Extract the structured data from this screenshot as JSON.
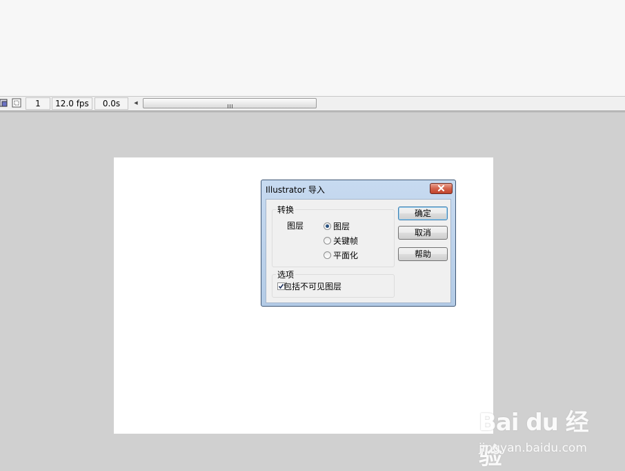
{
  "status_bar": {
    "frame": "1",
    "fps": "12.0 fps",
    "time": "0.0s",
    "scroll_left_icon": "scroll-left-arrow",
    "grip": "III"
  },
  "dialog": {
    "title": "Illustrator 导入",
    "convert_group": {
      "label": "转换",
      "row_label": "图层",
      "options": [
        {
          "label": "图层",
          "selected": true
        },
        {
          "label": "关键帧",
          "selected": false
        },
        {
          "label": "平面化",
          "selected": false
        }
      ]
    },
    "options_group": {
      "label": "选项",
      "include_invisible_label": "包括不可见图层",
      "include_invisible_checked": true
    },
    "buttons": {
      "ok": "确定",
      "cancel": "取消",
      "help": "帮助"
    }
  },
  "watermark": {
    "logo": "Bai du 经验",
    "url": "jingyan.baidu.com"
  },
  "colors": {
    "stage": "#ffffff",
    "workspace": "#d0d0d0",
    "close_button": "#c0442c",
    "title_bar": "#b9cfe9"
  }
}
